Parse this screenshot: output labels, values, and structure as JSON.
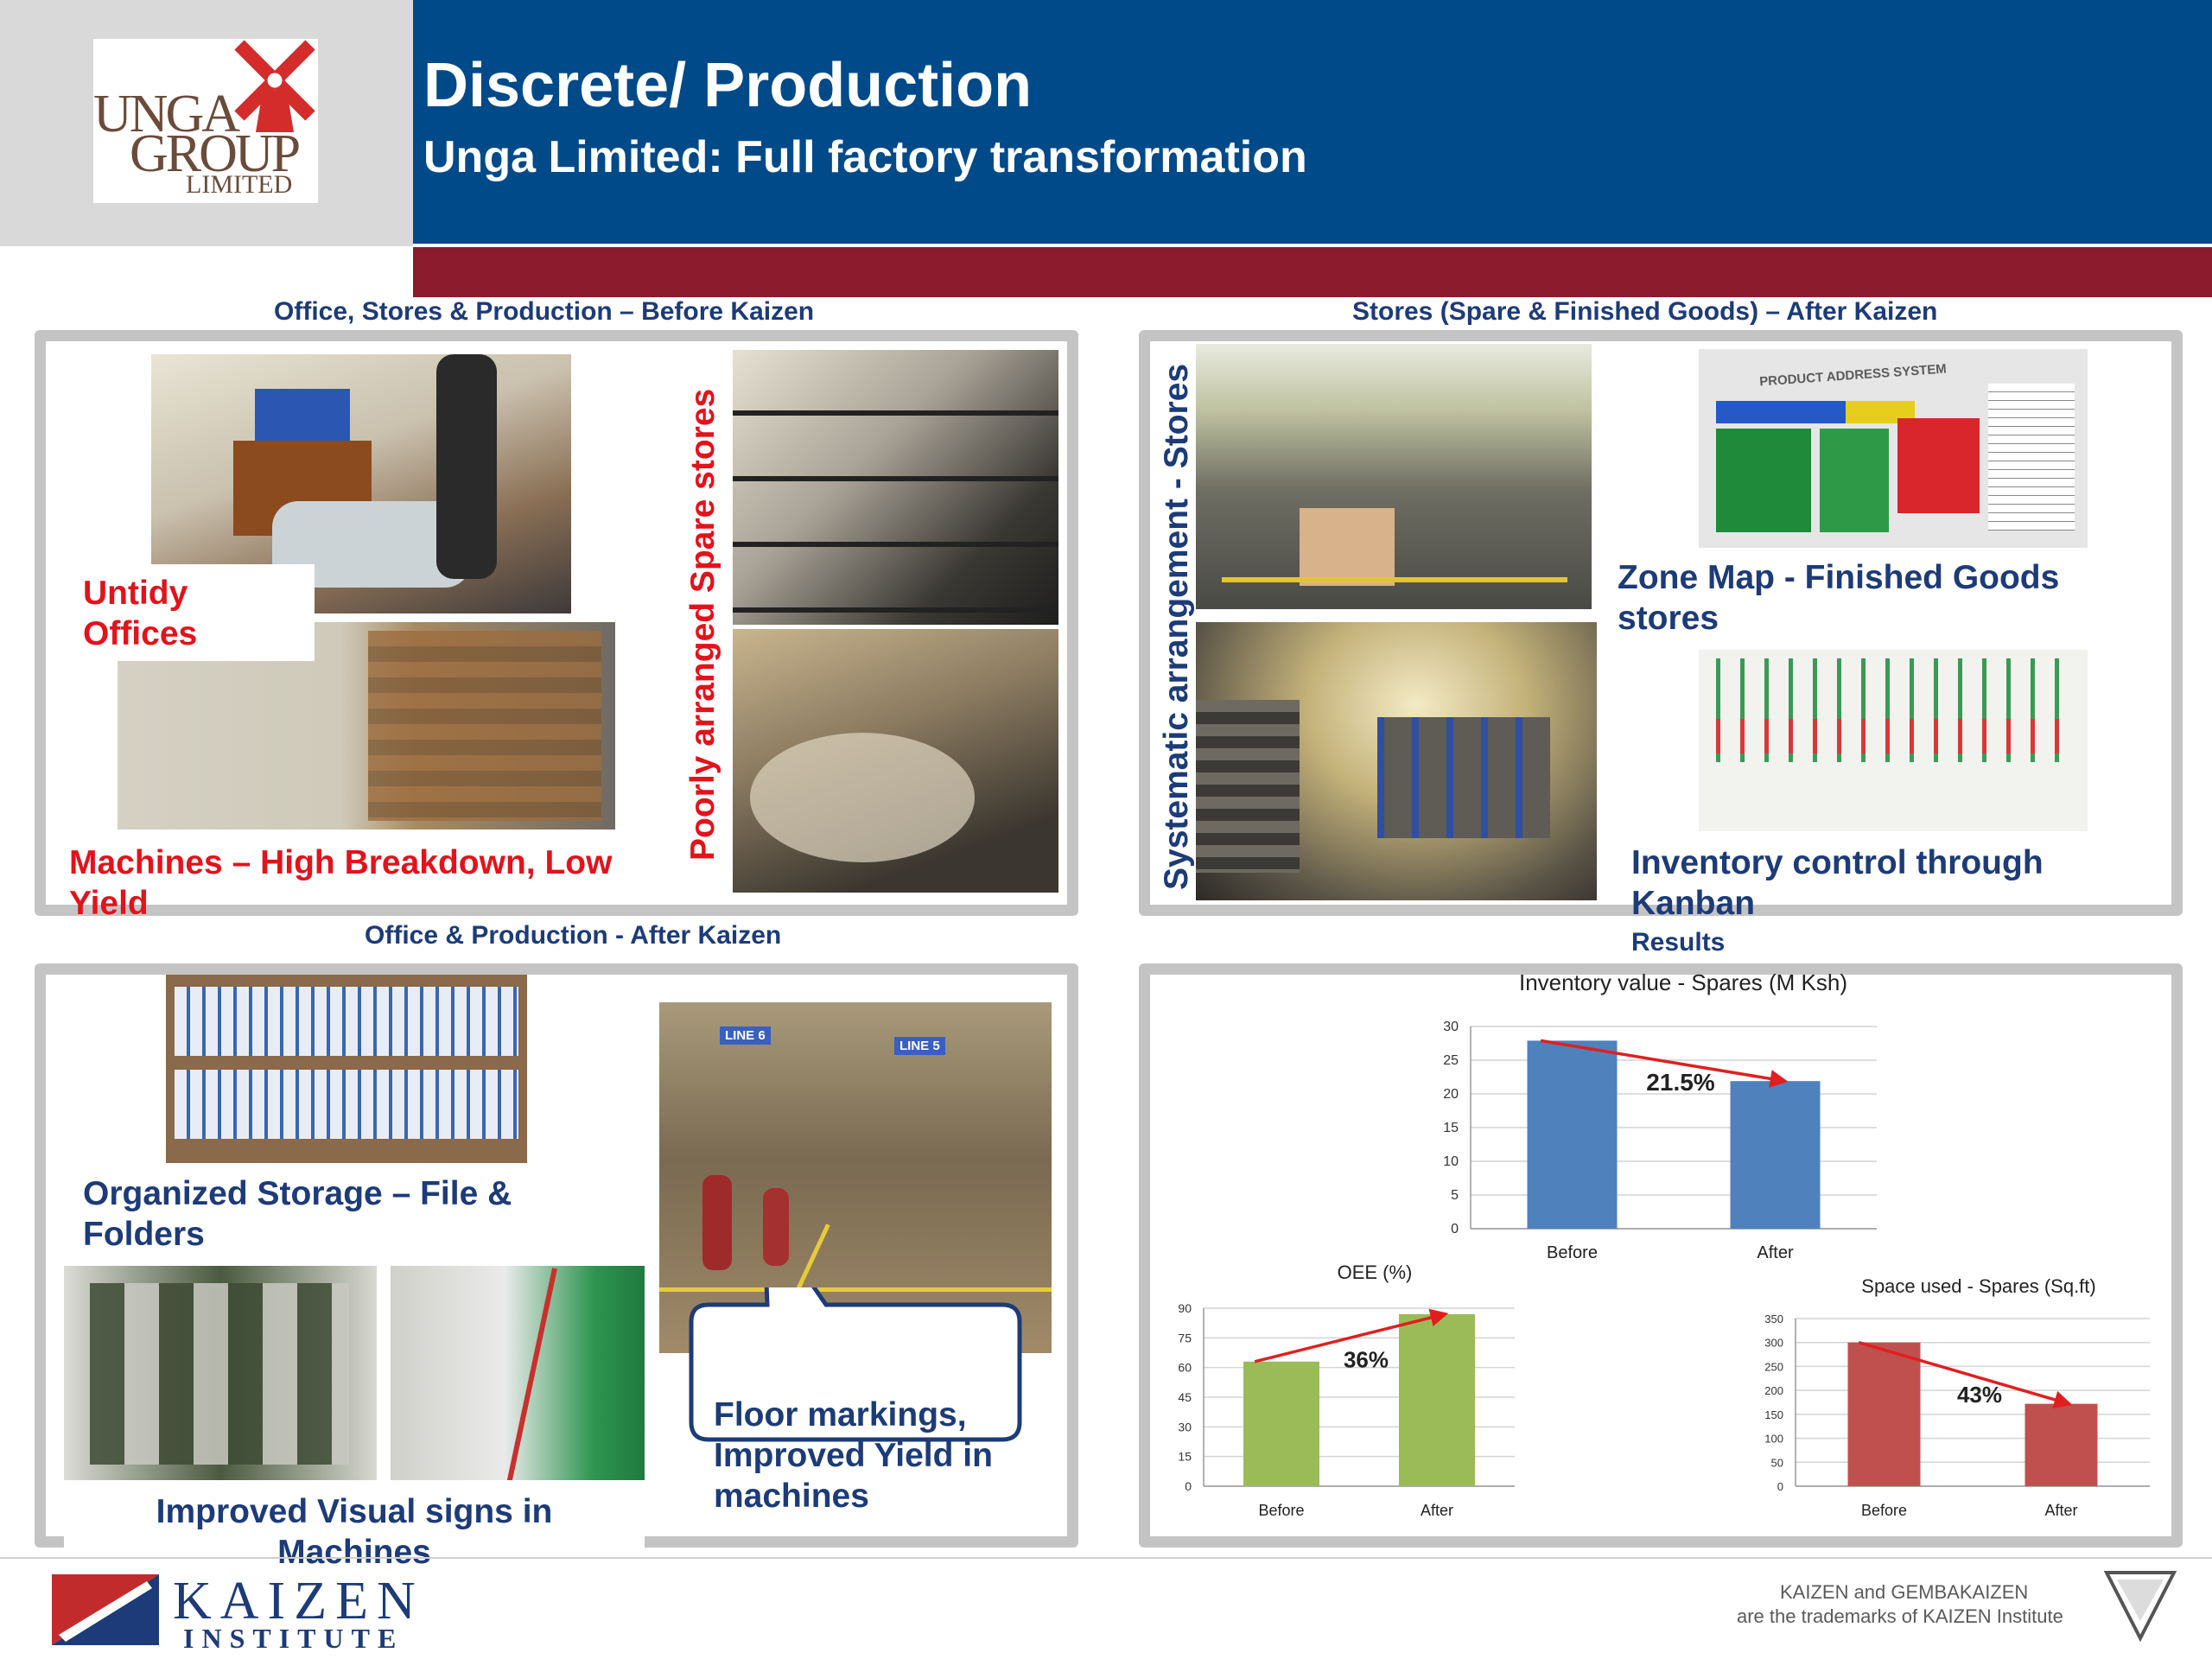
{
  "header": {
    "logo_lines": [
      "UNGA",
      "GROUP",
      "LIMITED"
    ],
    "title": "Discrete/ Production",
    "subtitle": "Unga Limited: Full factory transformation"
  },
  "sections": {
    "before_title": "Office, Stores & Production – Before Kaizen",
    "stores_after_title": "Stores (Spare & Finished Goods) – After Kaizen",
    "office_after_title": "Office & Production - After Kaizen",
    "results_title": "Results"
  },
  "captions": {
    "untidy_offices": "Untidy Offices",
    "machines_before": "Machines – High Breakdown, Low Yield",
    "poorly_spare": "Poorly arranged Spare stores",
    "systematic": "Systematic arrangement - Stores",
    "zone_map": "Zone Map - Finished Goods stores",
    "kanban": "Inventory control through Kanban",
    "organized_storage": "Organized Storage – File & Folders",
    "visual_signs": "Improved Visual signs in Machines",
    "floor_markings": "Floor markings, Improved Yield in machines"
  },
  "photo_labels": {
    "zone_map_header": "PRODUCT ADDRESS SYSTEM",
    "line_a": "LINE 6",
    "line_b": "LINE 5"
  },
  "colors": {
    "header_blue": "#004a89",
    "header_red": "#8c1b2e",
    "caption_red": "#e3121b",
    "caption_blue": "#1c3b78",
    "bar_blue": "#4f81bd",
    "bar_green": "#9bbb59",
    "bar_red": "#c0504d",
    "arrow_red": "#e01f1f"
  },
  "chart_data": [
    {
      "type": "bar",
      "title": "Inventory value - Spares (M Ksh)",
      "categories": [
        "Before",
        "After"
      ],
      "values": [
        27.9,
        21.9
      ],
      "ylim": [
        0,
        30
      ],
      "yticks": [
        0,
        5,
        10,
        15,
        20,
        25,
        30
      ],
      "annotation": "21.5%",
      "color": "#4f81bd",
      "grid": true
    },
    {
      "type": "bar",
      "title": "OEE (%)",
      "categories": [
        "Before",
        "After"
      ],
      "values": [
        63,
        87
      ],
      "ylim": [
        0,
        90
      ],
      "yticks": [
        0,
        15,
        30,
        45,
        60,
        75,
        90
      ],
      "annotation": "36%",
      "color": "#9bbb59",
      "grid": true
    },
    {
      "type": "bar",
      "title": "Space used - Spares (Sq.ft)",
      "categories": [
        "Before",
        "After"
      ],
      "values": [
        300,
        172
      ],
      "ylim": [
        0,
        350
      ],
      "yticks": [
        0,
        50,
        100,
        150,
        200,
        250,
        300,
        350
      ],
      "annotation": "43%",
      "color": "#c0504d",
      "grid": true
    }
  ],
  "footer": {
    "kaizen_word": "KAIZEN",
    "institute_word": "INSTITUTE",
    "trademark_line1": "KAIZEN and GEMBAKAIZEN",
    "trademark_line2": "are the trademarks of KAIZEN Institute"
  }
}
